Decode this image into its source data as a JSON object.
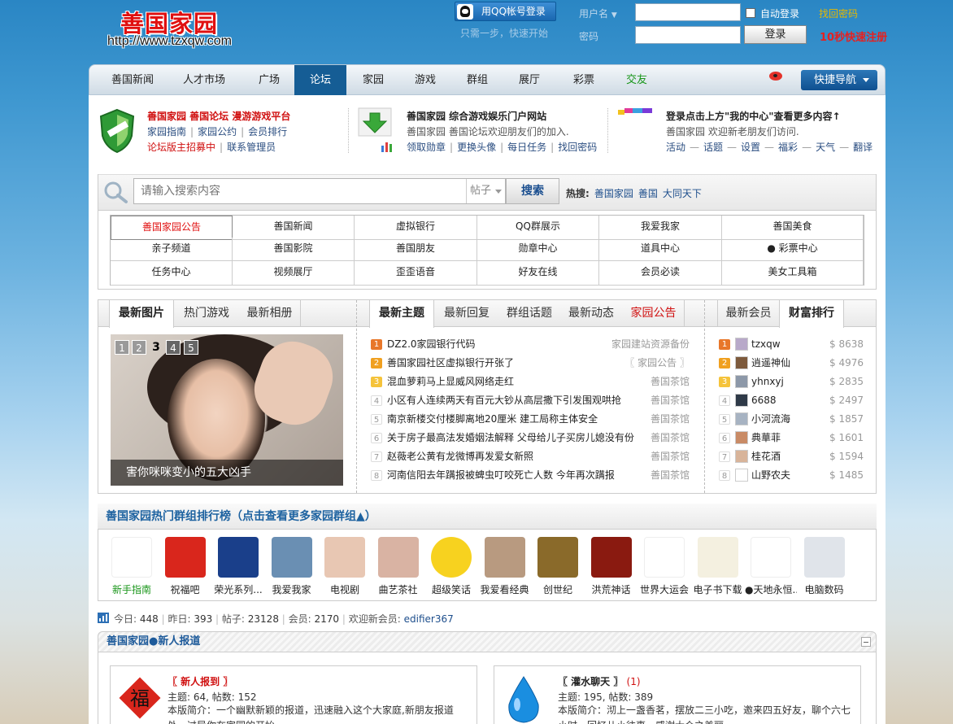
{
  "header": {
    "logo_text": "善国家园",
    "logo_url": "http://www.tzxqw.com",
    "qq_login": "用QQ帐号登录",
    "one_step": "只需一步，快速开始",
    "username_label": "用户名",
    "password_label": "密码",
    "auto_login": "自动登录",
    "forgot_password": "找回密码",
    "login_button": "登录",
    "register": "10秒快速注册"
  },
  "nav": {
    "items": [
      "善国新闻",
      "人才市场",
      "广场",
      "论坛",
      "家园",
      "游戏",
      "群组",
      "展厅",
      "彩票",
      "交友"
    ],
    "active_index": 3,
    "quick_nav": "快捷导航"
  },
  "banner": {
    "col1": {
      "title": "善国家园 善国论坛 漫游游戏平台",
      "links1": [
        "家园指南",
        "家园公约",
        "会员排行"
      ],
      "link_red": "论坛版主招募中",
      "link_contact": "联系管理员"
    },
    "col2": {
      "title": "善国家园 综合游戏娱乐门户网站",
      "desc": "善国家园 善国论坛欢迎朋友们的加入.",
      "links": [
        "领取勋章",
        "更换头像",
        "每日任务",
        "找回密码"
      ]
    },
    "col3": {
      "title": "登录点击上方\"我的中心\"查看更多内容↑",
      "desc": "善国家园 欢迎新老朋友们访问.",
      "links": [
        "活动",
        "话题",
        "设置",
        "福彩",
        "天气",
        "翻译"
      ]
    }
  },
  "search": {
    "placeholder": "请输入搜索内容",
    "type": "帖子",
    "button": "搜索",
    "hot_label": "热搜:",
    "hot": [
      "善国家园",
      "善国",
      "大同天下"
    ]
  },
  "quick_links": [
    [
      "善国家园公告",
      "善国新闻",
      "虚拟银行",
      "QQ群展示",
      "我爱我家",
      "善国美食"
    ],
    [
      "亲子频道",
      "善国影院",
      "善国朋友",
      "勋章中心",
      "道具中心",
      "● 彩票中心"
    ],
    [
      "任务中心",
      "视频展厅",
      "歪歪语音",
      "好友在线",
      "会员必读",
      "美女工具箱"
    ]
  ],
  "left_panel": {
    "tabs": [
      "最新图片",
      "热门游戏",
      "最新相册"
    ],
    "pages": [
      "1",
      "2",
      "3",
      "4",
      "5"
    ],
    "current_page": 3,
    "caption": "害你咪咪变小的五大凶手"
  },
  "mid_panel": {
    "tabs": [
      "最新主题",
      "最新回复",
      "群组话题",
      "最新动态",
      "家园公告"
    ],
    "items": [
      {
        "rank": "1",
        "title": "DZ2.0家园银行代码",
        "source": "家园建站资源备份"
      },
      {
        "rank": "2",
        "title": "善国家园社区虚拟银行开张了",
        "source": "〖 家园公告 〗"
      },
      {
        "rank": "3",
        "title": "混血萝莉马上显威风网络走红",
        "source": "善国茶馆"
      },
      {
        "rank": "4",
        "title": "小区有人连续两天有百元大钞从高层撒下引发围观哄抢",
        "source": "善国茶馆"
      },
      {
        "rank": "5",
        "title": "南京新楼交付楼脚离地20厘米 建工局称主体安全",
        "source": "善国茶馆"
      },
      {
        "rank": "6",
        "title": "关于房子最高法发婚姻法解释 父母给儿子买房儿媳没有份",
        "source": "善国茶馆"
      },
      {
        "rank": "7",
        "title": "赵薇老公黄有龙微博再发爱女新照",
        "source": "善国茶馆"
      },
      {
        "rank": "8",
        "title": "河南信阳去年蹒报被蜱虫叮咬死亡人数 今年再次蹒报",
        "source": "善国茶馆"
      }
    ]
  },
  "right_panel": {
    "tabs": [
      "最新会员",
      "财富排行"
    ],
    "items": [
      {
        "rank": "1",
        "name": "tzxqw",
        "amount": "$ 8638",
        "color": "#b8a9c9"
      },
      {
        "rank": "2",
        "name": "逍遥神仙",
        "amount": "$ 4976",
        "color": "#7d5a3c"
      },
      {
        "rank": "3",
        "name": "yhnxyj",
        "amount": "$ 2835",
        "color": "#8d98a8"
      },
      {
        "rank": "4",
        "name": "6688",
        "amount": "$ 2497",
        "color": "#2f3a48"
      },
      {
        "rank": "5",
        "name": "小河流海",
        "amount": "$ 1857",
        "color": "#a7b3c2"
      },
      {
        "rank": "6",
        "name": "典華菲",
        "amount": "$ 1601",
        "color": "#c98b66"
      },
      {
        "rank": "7",
        "name": "桂花酒",
        "amount": "$ 1594",
        "color": "#d8b49a"
      },
      {
        "rank": "8",
        "name": "山野农夫",
        "amount": "$ 1485",
        "color": "#ffffff"
      }
    ]
  },
  "groups": {
    "title": "善国家园热门群组排行榜（点击查看更多家园群组▲）",
    "items": [
      {
        "label": "新手指南",
        "icon": "guide-icon",
        "color": "#ffffff",
        "green": true
      },
      {
        "label": "祝福吧",
        "icon": "blessing-icon",
        "color": "#d9261c"
      },
      {
        "label": "荣光系列...",
        "icon": "car-icon",
        "color": "#1a3f8a"
      },
      {
        "label": "我爱我家",
        "icon": "family-icon",
        "color": "#6a8fb3"
      },
      {
        "label": "电视剧",
        "icon": "tv-drama-icon",
        "color": "#e8c7b3"
      },
      {
        "label": "曲艺茶社",
        "icon": "opera-icon",
        "color": "#d9b3a3"
      },
      {
        "label": "超级笑话",
        "icon": "smiley-icon",
        "color": "#f7d21f"
      },
      {
        "label": "我爱看经典",
        "icon": "classic-icon",
        "color": "#b89a80"
      },
      {
        "label": "创世纪",
        "icon": "genesis-icon",
        "color": "#8a6a2a"
      },
      {
        "label": "洪荒神话",
        "icon": "myth-icon",
        "color": "#8a1a10"
      },
      {
        "label": "世界大运会",
        "icon": "dragon-icon",
        "color": "#ffffff"
      },
      {
        "label": "电子书下载",
        "icon": "ebook-icon",
        "color": "#f4f0e0"
      },
      {
        "label": "●天地永恒...",
        "icon": "camera-icon",
        "color": "#ffffff"
      },
      {
        "label": "电脑数码",
        "icon": "laptop-icon",
        "color": "#e0e4ea"
      }
    ]
  },
  "stats": {
    "today_label": "今日:",
    "today": "448",
    "yesterday_label": "昨日:",
    "yesterday": "393",
    "posts_label": "帖子:",
    "posts": "23128",
    "members_label": "会员:",
    "members": "2170",
    "welcome_label": "欢迎新会员:",
    "new_member": "edifier367"
  },
  "section": {
    "title": "善国家园●新人报道",
    "forum1": {
      "name": "〖 新人报到 〗",
      "meta": "主题: 64, 帖数: 152",
      "desc": "本版简介：一个幽默新颖的报道，迅速融入这个大家庭,新朋友报道处，过导你在家园的开始"
    },
    "forum2": {
      "name": "〖 灌水聊天 〗",
      "new": "(1)",
      "meta": "主题: 195, 帖数: 389",
      "desc": "本版简介：沏上一盏香茗，摆放二三小吃，邀来四五好友，聊个六七小时，回忆儿小往事，感谢大众之美丽"
    }
  }
}
